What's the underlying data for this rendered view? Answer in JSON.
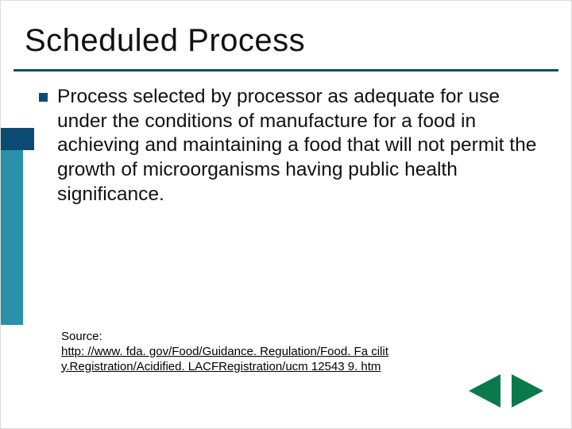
{
  "title": "Scheduled Process",
  "bullet": {
    "text": "Process selected by processor as adequate for use under the conditions of manufacture for a food in achieving and maintaining a food that will not permit the growth of microorganisms having public health significance."
  },
  "source": {
    "label": "Source:",
    "url_display": "http: //www. fda. gov/Food/Guidance. Regulation/Food. Fa cility.Registration/Acidified. LACFRegistration/ucm 12543 9. htm"
  },
  "colors": {
    "brand_dark": "#0b4b73",
    "brand_teal": "#2a91aa",
    "nav_green": "#0a7a4a"
  },
  "nav": {
    "prev_name": "previous-slide",
    "next_name": "next-slide"
  }
}
